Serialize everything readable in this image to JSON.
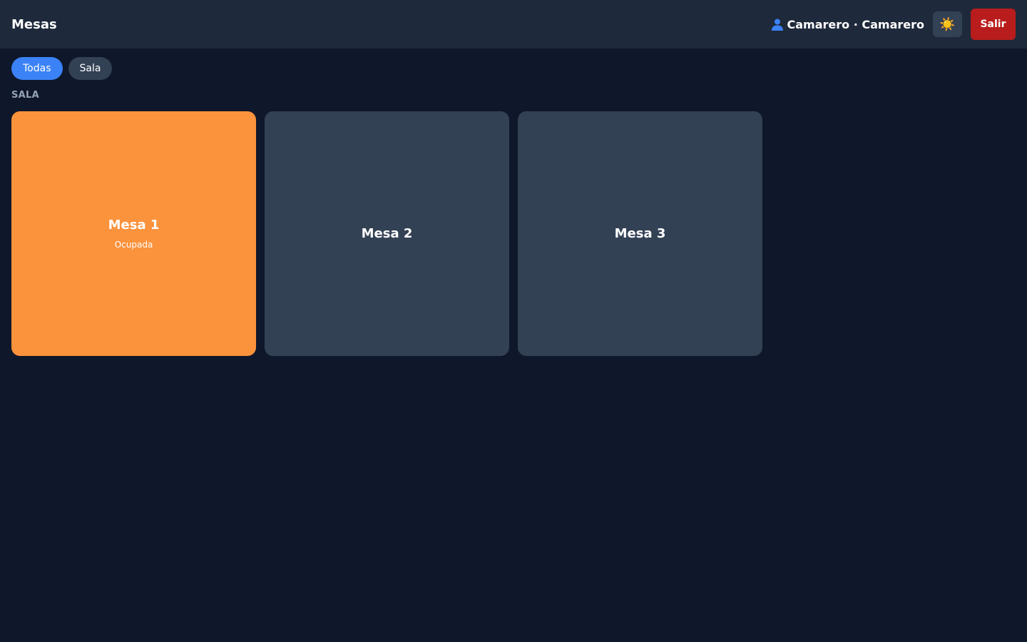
{
  "header": {
    "title": "Mesas",
    "user_label": "Camarero · Camarero",
    "theme_icon": "☀️",
    "logout_label": "Salir"
  },
  "filters": [
    {
      "label": "Todas",
      "active": true
    },
    {
      "label": "Sala",
      "active": false
    }
  ],
  "section": {
    "label": "SALA"
  },
  "tables": [
    {
      "name": "Mesa 1",
      "status": "Ocupada",
      "occupied": true,
      "color": "#fb923c"
    },
    {
      "name": "Mesa 2",
      "status": "",
      "occupied": false,
      "color": "#334155"
    },
    {
      "name": "Mesa 3",
      "status": "",
      "occupied": false,
      "color": "#334155"
    }
  ],
  "colors": {
    "background": "#0f172a",
    "topbar": "#1e293b",
    "accent": "#3b82f6",
    "danger": "#b91c1c",
    "occupied": "#fb923c"
  }
}
